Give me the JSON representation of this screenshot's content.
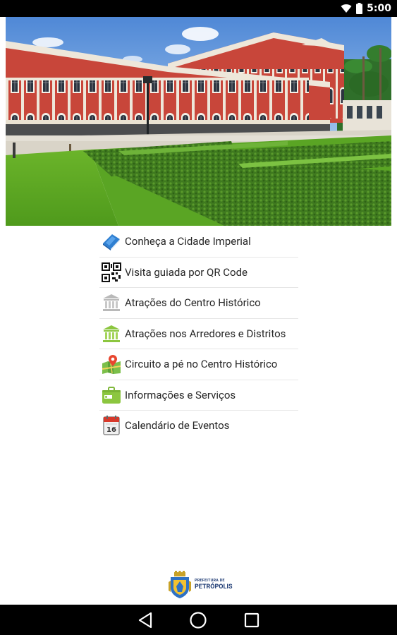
{
  "status_bar": {
    "time": "5:00",
    "icons": [
      "wifi-icon",
      "battery-icon"
    ]
  },
  "hero": {
    "icon": "imperial-museum-photo"
  },
  "menu": {
    "items": [
      {
        "label": "Conheça a Cidade Imperial",
        "icon": "book-icon"
      },
      {
        "label": "Visita guiada por QR Code",
        "icon": "qr-code-icon"
      },
      {
        "label": "Atrações do Centro Histórico",
        "icon": "museum-grey-icon"
      },
      {
        "label": "Atrações nos Arredores e Distritos",
        "icon": "museum-green-icon"
      },
      {
        "label": "Circuito a pé no Centro Histórico",
        "icon": "map-pin-icon"
      },
      {
        "label": "Informações e Serviços",
        "icon": "briefcase-icon"
      },
      {
        "label": "Calendário de Eventos",
        "icon": "calendar-icon"
      }
    ],
    "calendar_day": "16"
  },
  "logo": {
    "line1": "PREFEITURA DE",
    "line2": "PETRÓPOLIS"
  },
  "nav_bar": {
    "buttons": [
      "back-icon",
      "home-icon",
      "recents-icon"
    ]
  },
  "colors": {
    "accent_green": "#8cc63f",
    "text": "#262626",
    "divider": "#e6e6e6",
    "building_red": "#c0392b"
  }
}
